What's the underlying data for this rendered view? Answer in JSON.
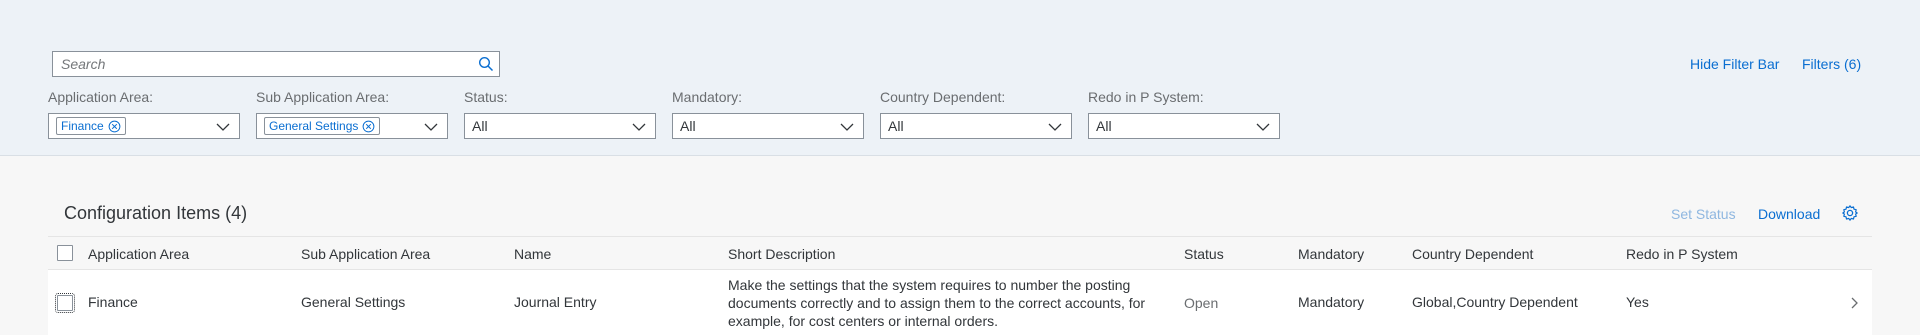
{
  "search": {
    "placeholder": "Search"
  },
  "filterbar_actions": {
    "hide": "Hide Filter Bar",
    "filters": "Filters (6)"
  },
  "filters": [
    {
      "label": "Application Area:",
      "token": "Finance"
    },
    {
      "label": "Sub Application Area:",
      "token": "General Settings"
    },
    {
      "label": "Status:",
      "value": "All"
    },
    {
      "label": "Mandatory:",
      "value": "All"
    },
    {
      "label": "Country Dependent:",
      "value": "All"
    },
    {
      "label": "Redo in P System:",
      "value": "All"
    }
  ],
  "table": {
    "title": "Configuration Items (4)",
    "actions": {
      "set_status": "Set Status",
      "download": "Download"
    },
    "columns": [
      "Application Area",
      "Sub Application Area",
      "Name",
      "Short Description",
      "Status",
      "Mandatory",
      "Country Dependent",
      "Redo in P System"
    ],
    "rows": [
      {
        "application_area": "Finance",
        "sub_application_area": "General Settings",
        "name": "Journal Entry",
        "short_description": "Make the settings that the system requires to number the posting documents correctly and to assign them to the correct accounts, for example, for cost centers or internal orders.",
        "status": "Open",
        "mandatory": "Mandatory",
        "country_dependent": "Global,Country Dependent",
        "redo_in_p_system": "Yes"
      }
    ]
  },
  "icons": {
    "search": "search-icon",
    "dropdown": "chevron-down-icon",
    "token_remove": "remove-circle-icon",
    "settings": "gear-icon",
    "navigate": "chevron-right-icon"
  },
  "colors": {
    "link": "#0a6ed1",
    "filterbar_bg": "#edf2f7",
    "text": "#32363a"
  }
}
